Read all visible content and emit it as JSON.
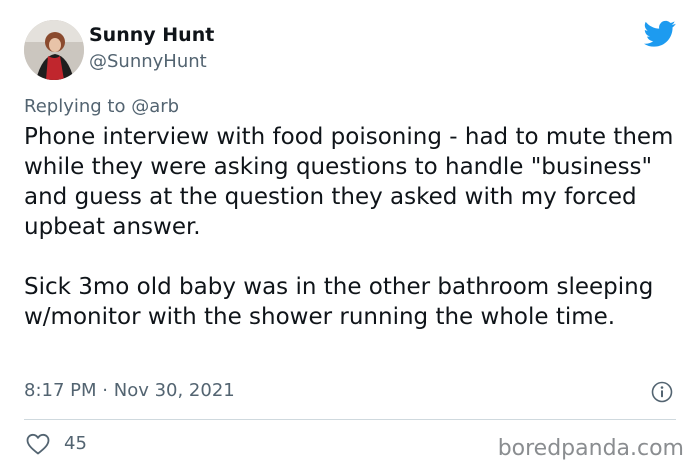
{
  "author": {
    "name": "Sunny Hunt",
    "handle": "@SunnyHunt"
  },
  "icons": {
    "brand": "twitter-bird-icon",
    "info": "info-icon",
    "like": "heart-icon"
  },
  "colors": {
    "twitter_blue": "#1d9bf0",
    "secondary_text": "#536471"
  },
  "reply": {
    "prefix": "Replying to",
    "to": "@arb"
  },
  "tweet": {
    "text": "Phone interview with food poisoning - had to mute them while they were asking questions to handle \"business\" and guess at the question they asked with my forced upbeat answer.\n\nSick 3mo old baby was in the other bathroom sleeping w/monitor with the shower running the whole time.",
    "time": "8:17 PM",
    "date": "Nov 30, 2021"
  },
  "stats": {
    "likes": "45"
  },
  "watermark": "boredpanda.com"
}
